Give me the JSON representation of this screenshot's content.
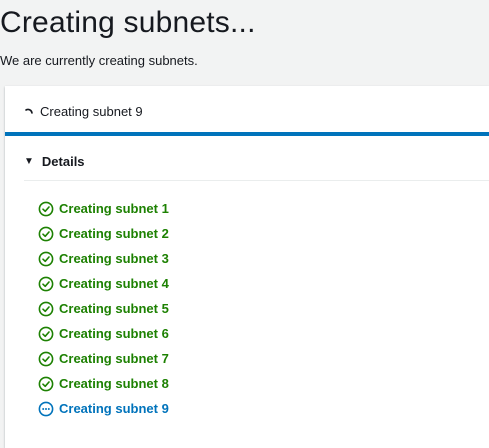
{
  "header": {
    "title": "Creating subnets...",
    "subtitle": "We are currently creating subnets."
  },
  "progress": {
    "label": "Creating subnet 9",
    "fraction": 1.0,
    "icon": "spinner-icon"
  },
  "details": {
    "label": "Details",
    "expanded": true,
    "items": [
      {
        "label": "Creating subnet 1",
        "status": "success",
        "icon": "success-check-icon"
      },
      {
        "label": "Creating subnet 2",
        "status": "success",
        "icon": "success-check-icon"
      },
      {
        "label": "Creating subnet 3",
        "status": "success",
        "icon": "success-check-icon"
      },
      {
        "label": "Creating subnet 4",
        "status": "success",
        "icon": "success-check-icon"
      },
      {
        "label": "Creating subnet 5",
        "status": "success",
        "icon": "success-check-icon"
      },
      {
        "label": "Creating subnet 6",
        "status": "success",
        "icon": "success-check-icon"
      },
      {
        "label": "Creating subnet 7",
        "status": "success",
        "icon": "success-check-icon"
      },
      {
        "label": "Creating subnet 8",
        "status": "success",
        "icon": "success-check-icon"
      },
      {
        "label": "Creating subnet 9",
        "status": "in-progress",
        "icon": "in-progress-icon"
      }
    ]
  },
  "colors": {
    "success": "#1d8102",
    "in_progress": "#0073bb",
    "progress_bar": "#0073bb",
    "background": "#f2f3f3"
  }
}
